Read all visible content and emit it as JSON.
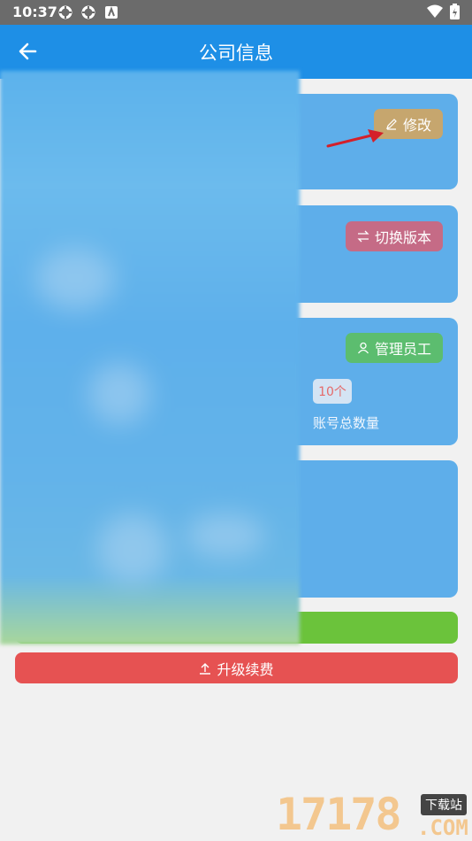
{
  "statusbar": {
    "time": "10:37"
  },
  "appbar": {
    "title": "公司信息"
  },
  "cards": {
    "edit_button": "修改",
    "switch_version_button": "切换版本",
    "manage_staff_button": "管理员工",
    "account_count_value": "10个",
    "account_count_label": "账号总数量"
  },
  "actions": {
    "upgrade_label": "升级续费"
  },
  "watermark": {
    "number": "17178",
    "site": "下载站",
    "domain": ".COM"
  },
  "colors": {
    "appbar": "#1e8fe6",
    "card": "#5eaeea",
    "edit": "#c6a66e",
    "version": "#c56b86",
    "staff": "#5cbd6f",
    "upgrade": "#e65252",
    "green": "#6bc33b"
  }
}
